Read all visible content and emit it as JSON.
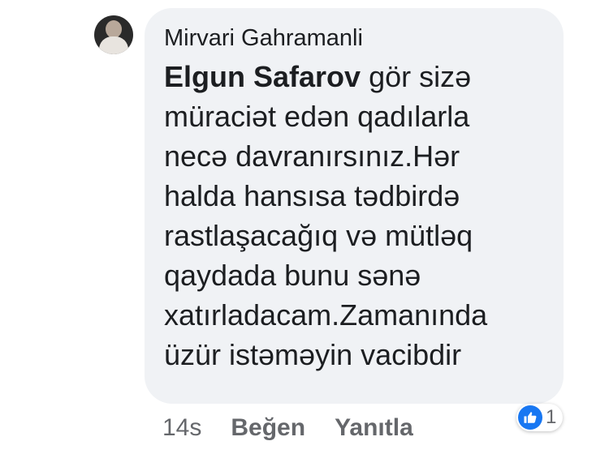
{
  "comment": {
    "author": "Mirvari Gahramanli",
    "mention": "Elgun Safarov",
    "lines": [
      " gör sizə",
      "müraciət edən qadılarla",
      "necə davranırsınız.Hər",
      "halda hansısa tədbirdə",
      "rastlaşacağıq və mütləq",
      "qaydada bunu sənə",
      "xatırladacam.Zamanında",
      "üzür istəməyin vacibdir"
    ]
  },
  "actions": {
    "time": "14s",
    "like_label": "Beğen",
    "reply_label": "Yanıtla"
  },
  "reactions": {
    "icon": "like-icon",
    "count": "1",
    "color": "#1877f2"
  }
}
